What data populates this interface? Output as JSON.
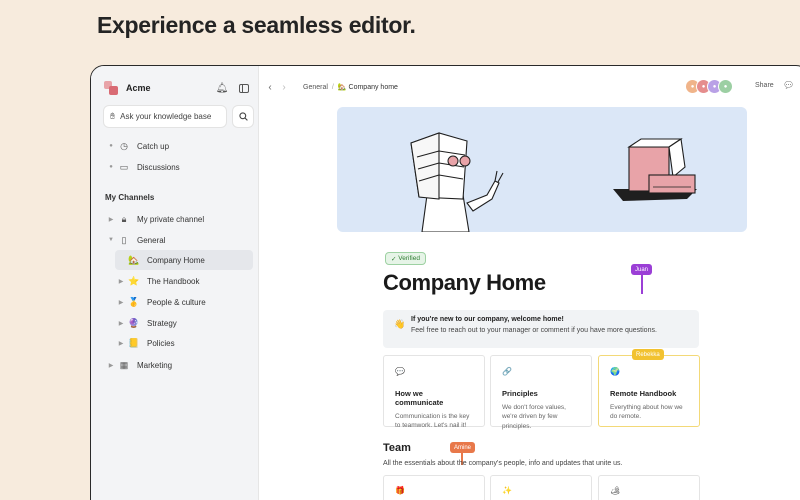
{
  "headline": "Experience a seamless editor.",
  "workspace": {
    "name": "Acme"
  },
  "search": {
    "placeholder": "Ask your knowledge base"
  },
  "nav": {
    "top_items": [
      {
        "label": "Catch up",
        "icon": "clock-icon"
      },
      {
        "label": "Discussions",
        "icon": "chat-icon"
      }
    ],
    "section_label": "My Channels",
    "channels": [
      {
        "label": "My private channel",
        "icon": "lock-icon"
      },
      {
        "label": "General",
        "icon": "channel-icon"
      },
      {
        "label": "Company Home",
        "icon": "house-icon",
        "active": true
      },
      {
        "label": "The Handbook",
        "icon": "star-icon"
      },
      {
        "label": "People & culture",
        "icon": "medal-icon"
      },
      {
        "label": "Strategy",
        "icon": "crystal-ball-icon"
      },
      {
        "label": "Policies",
        "icon": "notebook-icon"
      },
      {
        "label": "Marketing",
        "icon": "channel-icon"
      }
    ]
  },
  "breadcrumb": {
    "parent": "General",
    "current": "Company home"
  },
  "toolbar": {
    "share_label": "Share"
  },
  "page": {
    "verified_label": "Verified",
    "title": "Company Home",
    "cursors": [
      {
        "name": "Juan",
        "color": "#9b3fd6"
      },
      {
        "name": "Rebekka",
        "color": "#f2c230"
      },
      {
        "name": "Amine",
        "color": "#e8784a"
      }
    ],
    "callout": {
      "emoji": "👋",
      "title": "If you're new to our company, welcome home!",
      "body": "Feel free to reach out to your manager or comment if you have more questions."
    },
    "cards": [
      {
        "icon": "💬",
        "title": "How we communicate",
        "desc": "Communication is the key to teamwork. Let's nail it!"
      },
      {
        "icon": "🔗",
        "title": "Principles",
        "desc": "We don't force values, we're driven by few principles."
      },
      {
        "icon": "🌍",
        "title": "Remote Handbook",
        "desc": "Everything about how we do remote."
      }
    ],
    "team": {
      "heading": "Team",
      "desc": "All the essentials about the company's people, info and updates that unite us.",
      "card_icons": [
        "🎁",
        "✨",
        "🏕"
      ]
    }
  },
  "colors": {
    "background": "#f7ebdd",
    "hero": "#dbe7f7",
    "accent_pink": "#e8a3a8"
  }
}
